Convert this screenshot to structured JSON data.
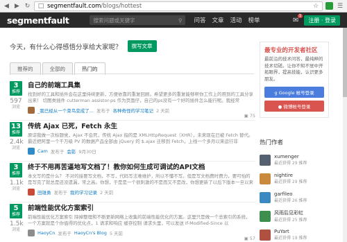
{
  "browser": {
    "url_host": "segmentfault.com",
    "url_path": "/blogs/hottest"
  },
  "header": {
    "logo": "segmentfault",
    "search_placeholder": "搜索问题或关键字",
    "nav": [
      "问答",
      "文章",
      "活动",
      "榜单"
    ],
    "mail_count": "1",
    "login_label": "注册 · 登录"
  },
  "compose": {
    "prompt": "今天，有什么心得感悟分享给大家呢？",
    "button": "撰写文章"
  },
  "tabs": [
    "推荐的",
    "全部的",
    "热门的"
  ],
  "articles": [
    {
      "votes": "3",
      "votes_label": "推荐",
      "views": "597",
      "views_label": "浏览",
      "title": "自己的前端工具集",
      "excerpt": "找到好的工具和插件会在这里持续更新，方便依靠的重复回顾。希望更多的重复能够帮你工作上的用到的工具分享出来！ 切图类插件 cutterman assistor-ps 作为页面仔，自己的ps没有一个好的插件怎么能行呢。我经常",
      "author": "_我已经从一个菜鸟变成了...",
      "source": "各种奇怪的学习笔记",
      "time": "2 天前",
      "bookmarks": "75",
      "avatar_color": "#a06a3c"
    },
    {
      "votes": "13",
      "votes_label": "推荐",
      "views": "2.4k",
      "views_label": "浏览",
      "title": "传统 Ajax 已死，Fetch 永生",
      "excerpt": "原谅我做一次标题党，Ajax 不会死，传统 Ajax 指的是 XMLHttpRequest（XHR），未来现在已被 Fetch 替代。 最近把阿里一个千万级 PV 的数据产品全部由 jQuery 的 $.ajax 迁移到 Fetch，上线一个多月以来运行非",
      "author": "Cam",
      "source": "会影",
      "time": "9月30日",
      "bookmarks": "",
      "avatar_color": "#2e8bc8"
    },
    {
      "votes": "3",
      "votes_label": "推荐",
      "views": "1.1k",
      "views_label": "浏览",
      "title": "终于不用再苦逼地写文档了！教你如何生成可调试的API文档",
      "excerpt": "本文写的是什么？ 不对的接要写文档，不写，代码写法难维护，所以不懂不写。但是写文档费时费力，要可怕的是写完了就总是还没遗漏，常之高。你想，于是是一个很刺激的不是而又不是改，你想更新了以后下版本一旦以来写完",
      "author": "田雄勇",
      "source": "我的学习记录",
      "time": "2 天前",
      "bookmarks": "",
      "avatar_color": "#c74b38"
    },
    {
      "votes": "5",
      "votes_label": "推荐",
      "views": "1.5k",
      "views_label": "浏览",
      "title": "前端性能优化方案索引",
      "excerpt": "前端性能优化方案索引 除掉整理和不断更新网络上收集的前端性能优化的方案。这里只是做一个总索引的系统，一个方案就是个你值得的优化点，1 请求和响应 缓存控制 请求头里，可以发送 If-Modified-Since 以",
      "author": "HaoyCn",
      "source": "HaoyCn's Blog",
      "time": "5 天前",
      "bookmarks": "57",
      "avatar_color": "#8d8d8d"
    }
  ],
  "promo": {
    "title": "最专业的开发者社区",
    "text": "最前沿的技术问答，最纯粹的技术切磋。让你不知不觉中开拓眼界，提高技能，认识更多朋友。",
    "google_label": "Google 帐号登录",
    "weibo_label": "微博帐号登录"
  },
  "authors": {
    "title": "热门作者",
    "list": [
      {
        "name": "xumenger",
        "stat": "最近获得 29 推荐",
        "color": "#556070"
      },
      {
        "name": "nightire",
        "stat": "最近获得 29 推荐",
        "color": "#c98a3d"
      },
      {
        "name": "garfileo",
        "stat": "最近获得 26 推荐",
        "color": "#3c88c0"
      },
      {
        "name": "风雨后见彩虹",
        "stat": "最近获得 25 推荐",
        "color": "#3d8f50"
      },
      {
        "name": "PuYart",
        "stat": "最近获得 19 推荐",
        "color": "#b05040"
      }
    ]
  }
}
